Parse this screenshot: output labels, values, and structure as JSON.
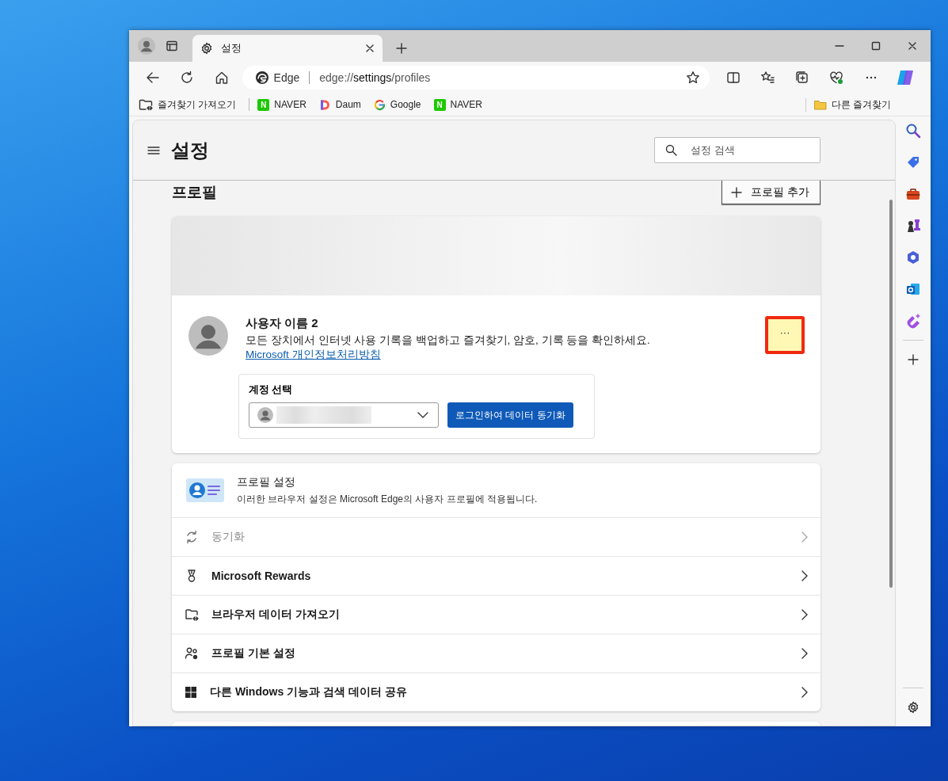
{
  "window": {
    "tabs": [
      {
        "title": "설정",
        "selected": true
      }
    ],
    "address": {
      "site_label": "Edge",
      "url": "edge://**settings**/profiles"
    }
  },
  "favorites": [
    {
      "label": "즐겨찾기 가져오기",
      "kind": "import"
    },
    {
      "label": "NAVER",
      "kind": "naver",
      "logo": "N"
    },
    {
      "label": "Daum",
      "kind": "daum"
    },
    {
      "label": "Google",
      "kind": "google"
    },
    {
      "label": "NAVER",
      "kind": "naver",
      "logo": "N"
    }
  ],
  "other_favorites": "다른 즐겨찾기",
  "settings": {
    "title": "설정",
    "search": {
      "placeholder": "설정 검색"
    },
    "section_title": "프로필",
    "add_profile_button": "프로필 추가",
    "profile": {
      "name": "사용자 이름 2",
      "description": "모든 장치에서 인터넷 사용 기록을 백업하고 즐겨찾기, 암호, 기록 등을 확인하세요.",
      "link": "Microsoft 개인정보처리방침",
      "more_button": "···",
      "more_highlighted": true,
      "account_select": {
        "label": "계정 선택"
      },
      "sync_button": "로그인하여 데이터 동기화"
    },
    "profile_settings": {
      "title": "프로필 설정",
      "subtitle": "이러한 브라우저 설정은 Microsoft Edge의 사용자 프로필에 적용됩니다.",
      "rows": [
        {
          "label": "동기화",
          "kind": "sync",
          "disabled": true
        },
        {
          "label": "Microsoft Rewards",
          "kind": "rewards",
          "disabled": false
        },
        {
          "label": "브라우저 데이터 가져오기",
          "kind": "import",
          "disabled": false
        },
        {
          "label": "프로필 기본 설정",
          "kind": "prefs",
          "disabled": false
        },
        {
          "label": "다른 Windows 기능과 검색 데이터 공유",
          "kind": "windows",
          "disabled": false
        }
      ]
    }
  }
}
